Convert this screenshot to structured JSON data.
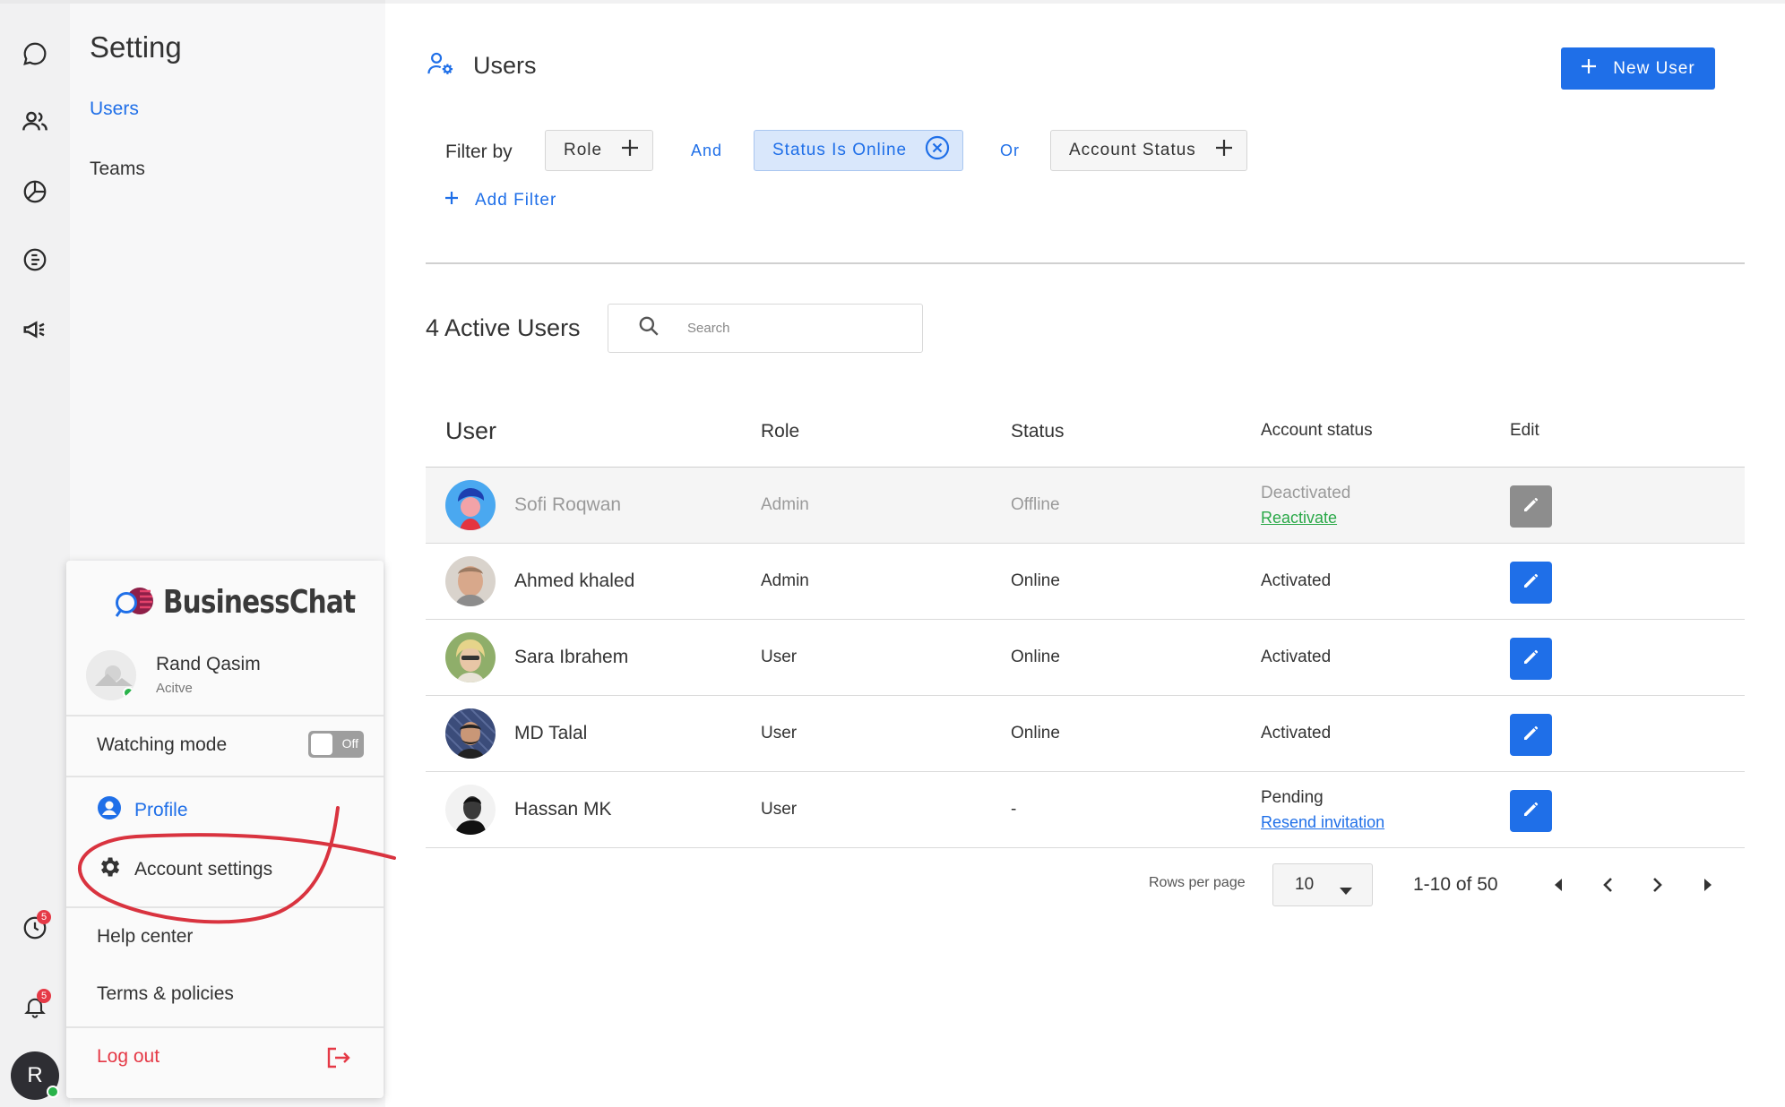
{
  "sidebar": {
    "title": "Setting",
    "items": [
      {
        "label": "Users",
        "active": true
      },
      {
        "label": "Teams",
        "active": false
      }
    ],
    "rail_icons": [
      "chat-icon",
      "users-icon",
      "pie-chart-icon",
      "report-icon",
      "megaphone-icon",
      "history-icon",
      "bell-icon"
    ],
    "history_badge": "5",
    "bell_badge": "5",
    "avatar_initial": "R"
  },
  "popup": {
    "brand": "BusinessChat",
    "user_name": "Rand Qasim",
    "user_status": "Acitve",
    "watching_mode_label": "Watching mode",
    "watching_mode_state": "Off",
    "profile_label": "Profile",
    "account_settings_label": "Account settings",
    "help_center_label": "Help center",
    "terms_label": "Terms & policies",
    "logout_label": "Log out"
  },
  "header": {
    "title": "Users",
    "new_user_label": "New User"
  },
  "filters": {
    "filter_by_label": "Filter by",
    "chips": [
      {
        "label": "Role"
      },
      {
        "label": "Status Is Online",
        "active": true
      },
      {
        "label": "Account Status"
      }
    ],
    "ops": [
      "And",
      "Or"
    ],
    "add_filter_label": "Add Filter"
  },
  "list": {
    "active_count_label": "4 Active Users",
    "search_placeholder": "Search",
    "columns": [
      "User",
      "Role",
      "Status",
      "Account status",
      "Edit"
    ],
    "rows": [
      {
        "name": "Sofi Roqwan",
        "role": "Admin",
        "status": "Offline",
        "account_status": "Deactivated",
        "action_link": "Reactivate",
        "disabled": true
      },
      {
        "name": "Ahmed khaled",
        "role": "Admin",
        "status": "Online",
        "account_status": "Activated",
        "action_link": ""
      },
      {
        "name": "Sara Ibrahem",
        "role": "User",
        "status": "Online",
        "account_status": "Activated",
        "action_link": ""
      },
      {
        "name": "MD Talal",
        "role": "User",
        "status": "Online",
        "account_status": "Activated",
        "action_link": ""
      },
      {
        "name": "Hassan MK",
        "role": "User",
        "status": "-",
        "account_status": "Pending",
        "action_link": "Resend invitation"
      }
    ]
  },
  "pagination": {
    "rows_per_page_label": "Rows per page",
    "rows_per_page_value": "10",
    "range_label": "1-10 of 50"
  },
  "colors": {
    "accent": "#1f6fe8",
    "danger": "#e53946",
    "success_link": "#29a847",
    "annotation": "#d9333f"
  }
}
